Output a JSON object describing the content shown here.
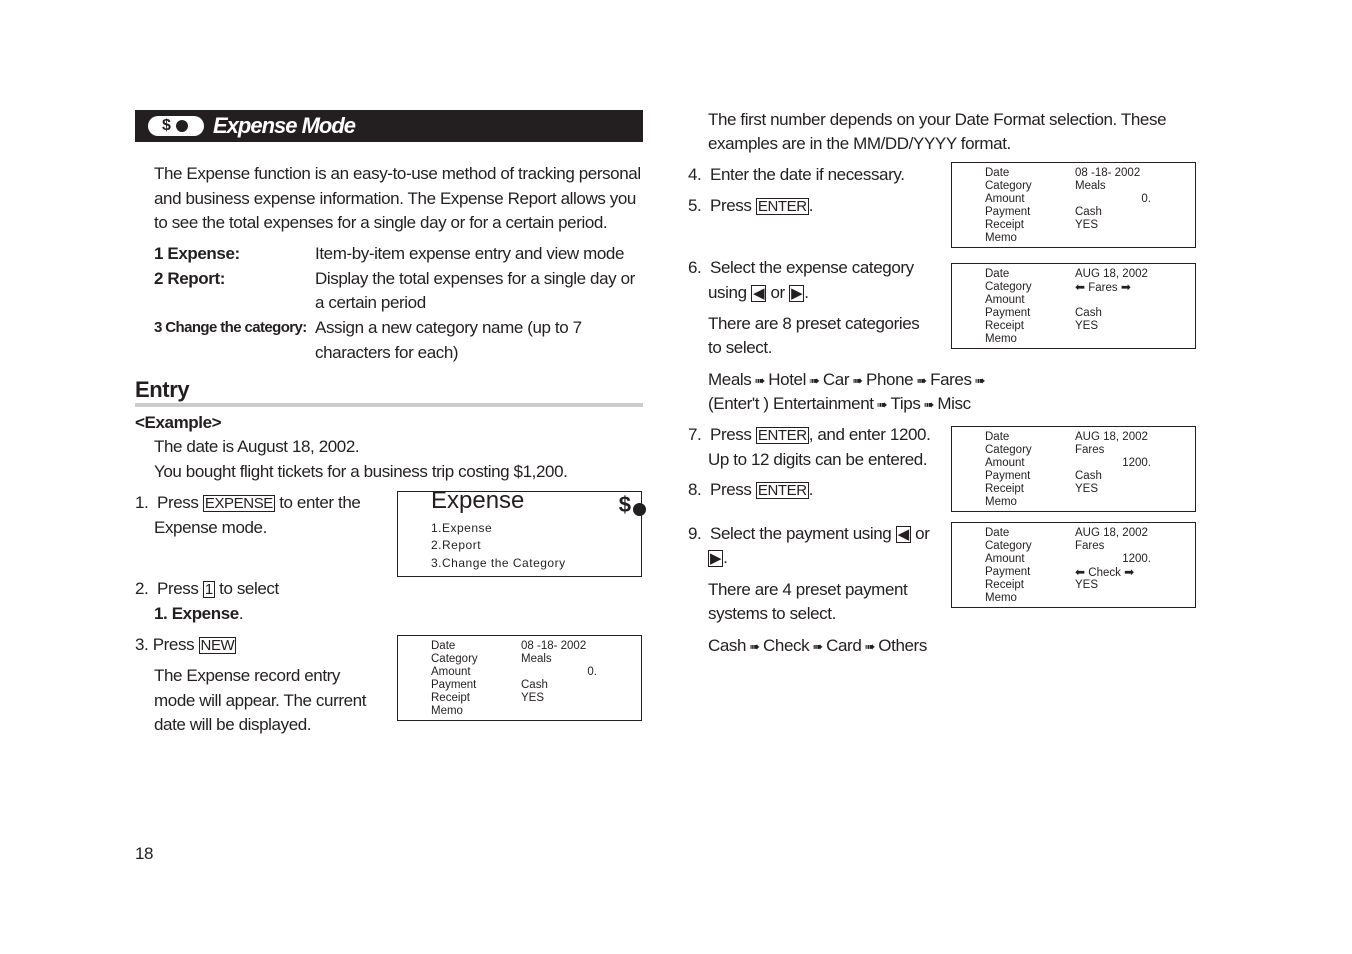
{
  "header": {
    "title": "Expense Mode",
    "icon": "dollar-coin-icon"
  },
  "intro": [
    "The Expense function is an easy-to-use method of tracking personal",
    "and business expense information. The Expense Report allows you",
    "to see the total expenses for a single day or for a certain period."
  ],
  "modes": [
    {
      "label": "1 Expense:",
      "desc": [
        "Item-by-item expense entry and view mode"
      ]
    },
    {
      "label": "2 Report:",
      "desc": [
        "Display the total expenses for a single day or",
        "a certain period"
      ]
    },
    {
      "label": "3 Change the category:",
      "desc": [
        "Assign a new category name (up to 7",
        "characters for each)"
      ]
    }
  ],
  "entry": {
    "heading": "Entry",
    "example_label": "<Example>",
    "example": [
      "The date is August 18, 2002.",
      "You bought flight tickets for a business trip costing  $1,200."
    ]
  },
  "steps": {
    "s1": {
      "num": "1.",
      "pre": "Press",
      "key": "EXPENSE",
      "post": "to enter the",
      "line2": "Expense mode."
    },
    "s2": {
      "num": "2.",
      "pre": "Press",
      "key": "1",
      "post": "to select",
      "line2": "1. Expense",
      "line2_end": "."
    },
    "s3": {
      "num": "3.",
      "pre": "Press",
      "key": "NEW",
      "lines": [
        "The Expense record entry",
        "mode will appear. The current",
        "date will be displayed."
      ]
    },
    "note": [
      "The first number depends on your Date Format selection. These",
      "examples are in the MM/DD/YYYY format."
    ],
    "s4": {
      "num": "4.",
      "text": "Enter the date if necessary."
    },
    "s5": {
      "num": "5.",
      "pre": "Press",
      "key": "ENTER",
      "post": "."
    },
    "s6": {
      "num": "6.",
      "line1": "Select the expense category",
      "using": "using",
      "or": "or",
      "lines": [
        "There are 8 preset categories",
        "to select."
      ],
      "cycle1": [
        "Meals",
        "Hotel",
        "Car",
        "Phone",
        "Fares"
      ],
      "cycle2": [
        "(Enter't ) Entertainment",
        "Tips",
        "Misc"
      ]
    },
    "s7": {
      "num": "7.",
      "pre": "Press",
      "key": "ENTER",
      "post": ", and enter 1200.",
      "line2": "Up to 12 digits can be entered."
    },
    "s8": {
      "num": "8.",
      "pre": "Press",
      "key": "ENTER",
      "post": "."
    },
    "s9": {
      "num": "9.",
      "line1": "Select the payment using",
      "or": "or",
      "lines": [
        "There are 4 preset payment",
        "systems to select."
      ],
      "cycle": [
        "Cash",
        "Check",
        "Card",
        "Others"
      ]
    }
  },
  "menu_screen": {
    "title": "Expense",
    "items": [
      "1.Expense",
      "2.Report",
      "3.Change the Category"
    ],
    "icon": "$"
  },
  "field_labels": [
    "Date",
    "Category",
    "Amount",
    "Payment",
    "Receipt",
    "Memo"
  ],
  "screens": [
    {
      "values": [
        "08 -18- 2002",
        "Meals",
        "0.",
        "Cash",
        "YES",
        ""
      ]
    },
    {
      "values": [
        "08 -18- 2002",
        "Meals",
        "0.",
        "Cash",
        "YES",
        ""
      ]
    },
    {
      "values": [
        "AUG 18, 2002",
        "Fares",
        "",
        "Cash",
        "YES",
        ""
      ]
    },
    {
      "values": [
        "AUG 18, 2002",
        "Fares",
        "1200.",
        "Cash",
        "YES",
        ""
      ]
    },
    {
      "values": [
        "AUG 18, 2002",
        "Fares",
        "1200.",
        "Check",
        "YES",
        ""
      ]
    }
  ],
  "page_number": "18"
}
